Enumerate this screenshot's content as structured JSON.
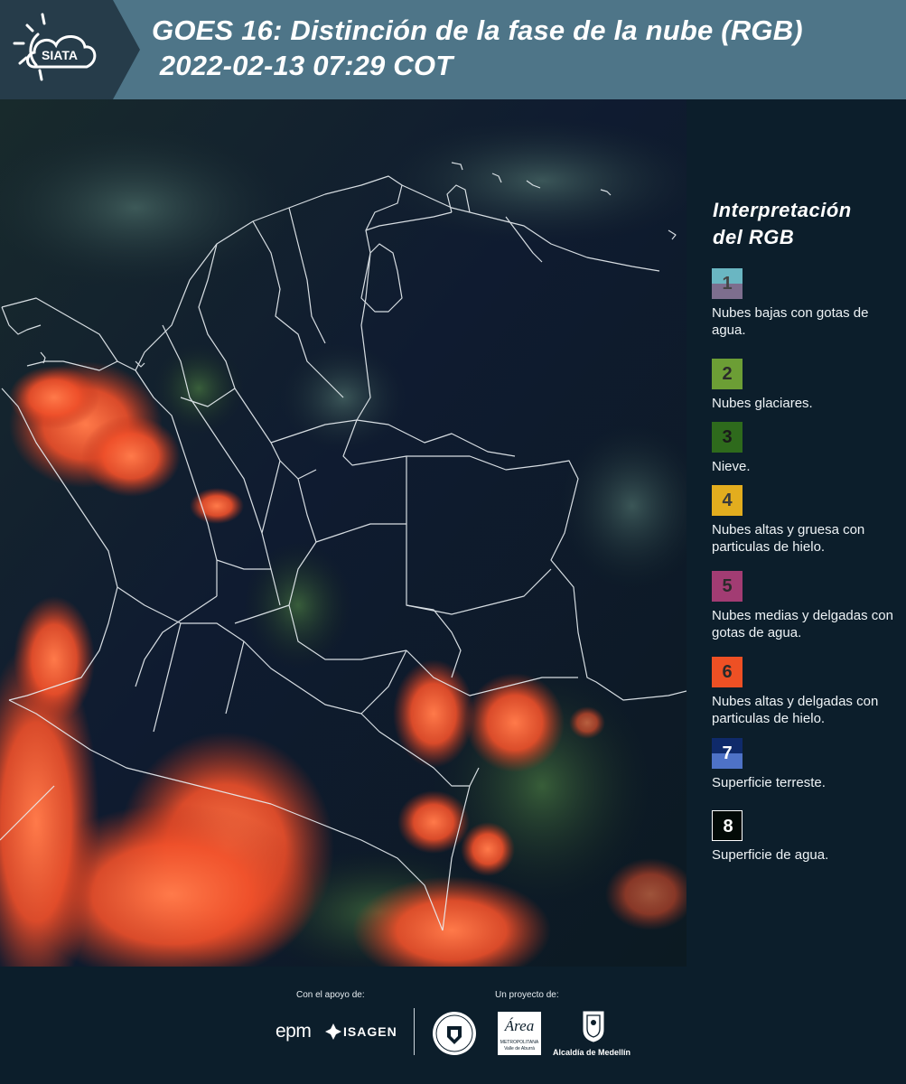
{
  "header": {
    "logo_text": "SIATA",
    "title_line1": "GOES 16: Distinción de la fase de la nube (RGB)",
    "title_line2": " 2022-02-13 07:29 COT"
  },
  "legend": {
    "title_line1": "Interpretación",
    "title_line2": "del RGB",
    "items": [
      {
        "num": "1",
        "desc": "Nubes bajas con gotas de agua.",
        "color_top": "#6ab6c2",
        "color_bottom": "#7d6e8e",
        "num_color": "#444444"
      },
      {
        "num": "2",
        "desc": "Nubes glaciares.",
        "color_top": "#6c9e35",
        "color_bottom": "#6c9e35",
        "num_color": "#2b2b2b"
      },
      {
        "num": "3",
        "desc": "Nieve.",
        "color_top": "#2e6a1c",
        "color_bottom": "#2e6a1c",
        "num_color": "#1a1a1a"
      },
      {
        "num": "4",
        "desc": "Nubes altas y gruesa con particulas de hielo.",
        "color_top": "#e3ad1e",
        "color_bottom": "#e3ad1e",
        "num_color": "#3a3a3a"
      },
      {
        "num": "5",
        "desc": "Nubes medias y delgadas con gotas de agua.",
        "color_top": "#a23c73",
        "color_bottom": "#a23c73",
        "num_color": "#2a2a2a"
      },
      {
        "num": "6",
        "desc": "Nubes altas y delgadas con particulas de hielo.",
        "color_top": "#ee5024",
        "color_bottom": "#ee5024",
        "num_color": "#2a2a2a"
      },
      {
        "num": "7",
        "desc": "Superficie terreste.",
        "color_top": "#0f2a6a",
        "color_bottom": "#4e72c6",
        "num_color": "#ffffff"
      },
      {
        "num": "8",
        "desc": "Superficie de agua.",
        "color_top": "#030a07",
        "color_bottom": "#030a07",
        "num_color": "#ffffff"
      }
    ]
  },
  "footer": {
    "support_label": "Con el apoyo de:",
    "project_label": "Un proyecto de:",
    "epm": "epm",
    "isagen": "ISAGEN",
    "area_text": "Área",
    "area_sub1": "METROPOLITANA",
    "area_sub2": "Valle de Aburrá",
    "alcaldia": "Alcaldía de Medellín"
  }
}
